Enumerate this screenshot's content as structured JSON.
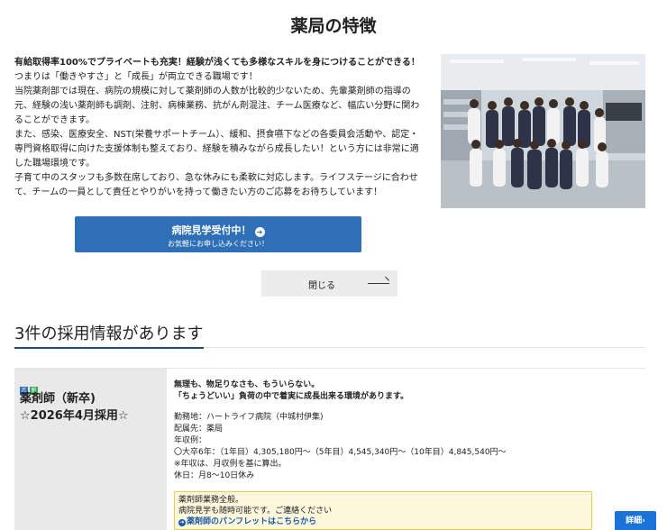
{
  "section": {
    "title": "薬局の特徴"
  },
  "feature": {
    "lead": "有給取得率100%でプライベートも充実！経験が浅くても多様なスキルを身につけることができる！",
    "p1": "つまりは「働きやすさ」と「成長」が両立できる職場です！",
    "p2": "当院薬剤部では現在、病院の規模に対して薬剤師の人数が比較的少ないため、先輩薬剤師の指導の元、経験の浅い薬剤師も調剤、注射、病棟業務、抗がん剤混注、チーム医療など、幅広い分野に関わることができます。",
    "p3": "また、感染、医療安全、NST(栄養サポートチーム）、緩和、摂食嚥下などの各委員会活動や、認定・専門資格取得に向けた支援体制も整えており、経験を積みながら成長したい！という方には非常に適した職場環境です。",
    "p4": "子育て中のスタッフも多数在席しており、急な休みにも柔軟に対応します。ライフステージに合わせて、チームの一員として責任とやりがいを持って働きたい方のご応募をお待ちしています！"
  },
  "cta": {
    "main": "病院見学受付中！",
    "sub": "お気軽にお申し込みください！",
    "icon": "arrow-right-circle-icon"
  },
  "close": {
    "label": "閉じる"
  },
  "jobs": {
    "heading": "3件の採用情報があります",
    "card": {
      "badges": [
        "正",
        "新"
      ],
      "title_line1": "薬剤師（新卒)",
      "title_line2": "☆2026年4月採用☆",
      "catch1": "無理も、物足りなさも、もういらない。",
      "catch2": "「ちょうどいい」負荷の中で着実に成長出来る環境があります。",
      "location": "勤務地：ハートライフ病院（中城村伊集)",
      "department": "配属先：薬局",
      "salary_label": "年収例：",
      "salary": "〇大卒6年：（1年目）4,305,180円〜（5年目）4,545,340円〜（10年目）4,845,540円〜",
      "salary_note": "※年収は、月収例を基に算出。",
      "holidays": "休日：月8〜10日休み",
      "note1": "薬剤師業務全般。",
      "note2": "病院見学も随時可能です。ご連絡ください",
      "note_link": "薬剤師のパンフレットはこちらから",
      "detail_button": "詳細"
    }
  },
  "colors": {
    "primary": "#2f6fb7",
    "accent": "#1a73d9",
    "note_bg": "#fdf7dc",
    "note_border": "#f0c84a"
  }
}
